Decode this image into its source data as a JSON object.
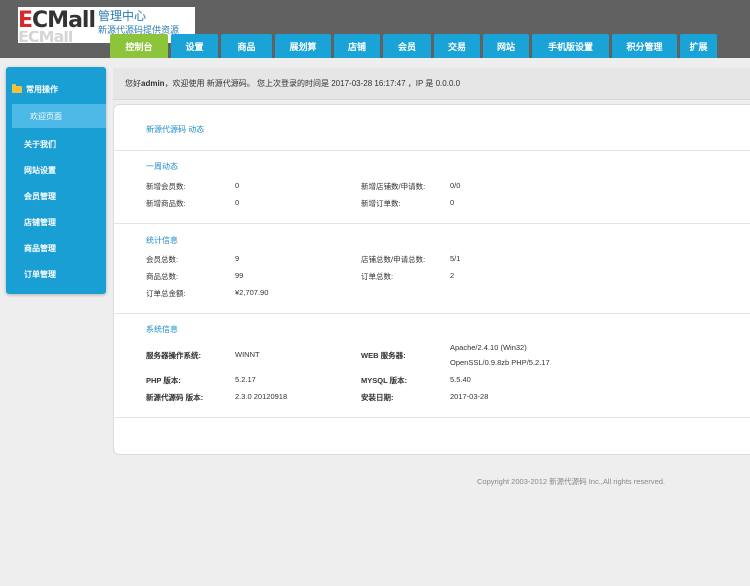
{
  "header": {
    "logo_brand": "ECMall",
    "logo_title": "管理中心",
    "logo_subtitle": "新源代源码提供资源"
  },
  "nav": {
    "items": [
      {
        "label": "控制台",
        "active": true
      },
      {
        "label": "设置"
      },
      {
        "label": "商品"
      },
      {
        "label": "展划算"
      },
      {
        "label": "店铺"
      },
      {
        "label": "会员"
      },
      {
        "label": "交易"
      },
      {
        "label": "网站"
      },
      {
        "label": "手机版设置"
      },
      {
        "label": "积分管理"
      },
      {
        "label": "扩展"
      }
    ]
  },
  "sidebar": {
    "heading": "常用操作",
    "items": [
      {
        "label": "欢迎页面",
        "active": true
      },
      {
        "label": "关于我们"
      },
      {
        "label": "网站设置"
      },
      {
        "label": "会员管理"
      },
      {
        "label": "店铺管理"
      },
      {
        "label": "商品管理"
      },
      {
        "label": "订单管理"
      }
    ]
  },
  "welcome": {
    "prefix": "您好",
    "user": "admin",
    "text": "，欢迎使用 新源代源码。 您上次登录的时间是 2017-03-28 16:17:47 ，IP 是 0.0.0.0"
  },
  "main": {
    "title": "新源代源码 动态",
    "week": {
      "title": "一周动态",
      "new_members_label": "新增会员数:",
      "new_members_value": "0",
      "new_stores_label": "新增店铺数/申请数:",
      "new_stores_value": "0/0",
      "new_goods_label": "新增商品数:",
      "new_goods_value": "0",
      "new_orders_label": "新增订单数:",
      "new_orders_value": "0"
    },
    "stats": {
      "title": "统计信息",
      "members_label": "会员总数:",
      "members_value": "9",
      "stores_label": "店铺总数/申请总数:",
      "stores_value": "5/1",
      "goods_label": "商品总数:",
      "goods_value": "99",
      "orders_label": "订单总数:",
      "orders_value": "2",
      "amount_label": "订单总金额:",
      "amount_value": "¥2,707.90"
    },
    "system": {
      "title": "系统信息",
      "os_label": "服务器操作系统:",
      "os_value": "WINNT",
      "web_label": "WEB 服务器:",
      "web_value_1": "Apache/2.4.10 (Win32)",
      "web_value_2": "OpenSSL/0.9.8zb PHP/5.2.17",
      "php_label": "PHP 版本:",
      "php_value": "5.2.17",
      "mysql_label": "MYSQL 版本:",
      "mysql_value": "5.5.40",
      "version_label": "新源代源码 版本:",
      "version_value": "2.3.0 20120918",
      "install_label": "安装日期:",
      "install_value": "2017-03-28"
    }
  },
  "footer": {
    "copyright": "Copyright 2003-2012 新源代源码 Inc.,All rights reserved."
  },
  "colors": {
    "header_bg": "#616161",
    "nav_bg": "#1aa3d6",
    "nav_active": "#8cc43c",
    "sidebar_bg": "#1a9fd4",
    "link_blue": "#1a8cc8"
  }
}
